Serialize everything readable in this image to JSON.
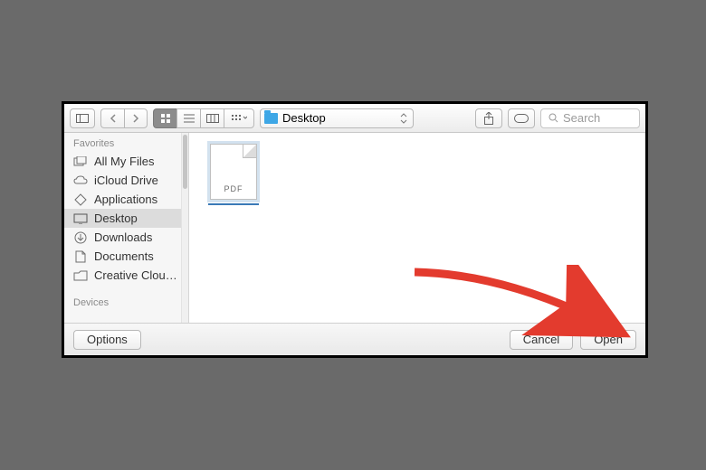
{
  "toolbar": {
    "folder_label": "Desktop",
    "search_placeholder": "Search"
  },
  "sidebar": {
    "section_favorites": "Favorites",
    "section_devices": "Devices",
    "items": [
      {
        "label": "All My Files"
      },
      {
        "label": "iCloud Drive"
      },
      {
        "label": "Applications"
      },
      {
        "label": "Desktop"
      },
      {
        "label": "Downloads"
      },
      {
        "label": "Documents"
      },
      {
        "label": "Creative Clou…"
      }
    ]
  },
  "content": {
    "file_badge": "PDF"
  },
  "footer": {
    "options_label": "Options",
    "cancel_label": "Cancel",
    "open_label": "Open"
  }
}
